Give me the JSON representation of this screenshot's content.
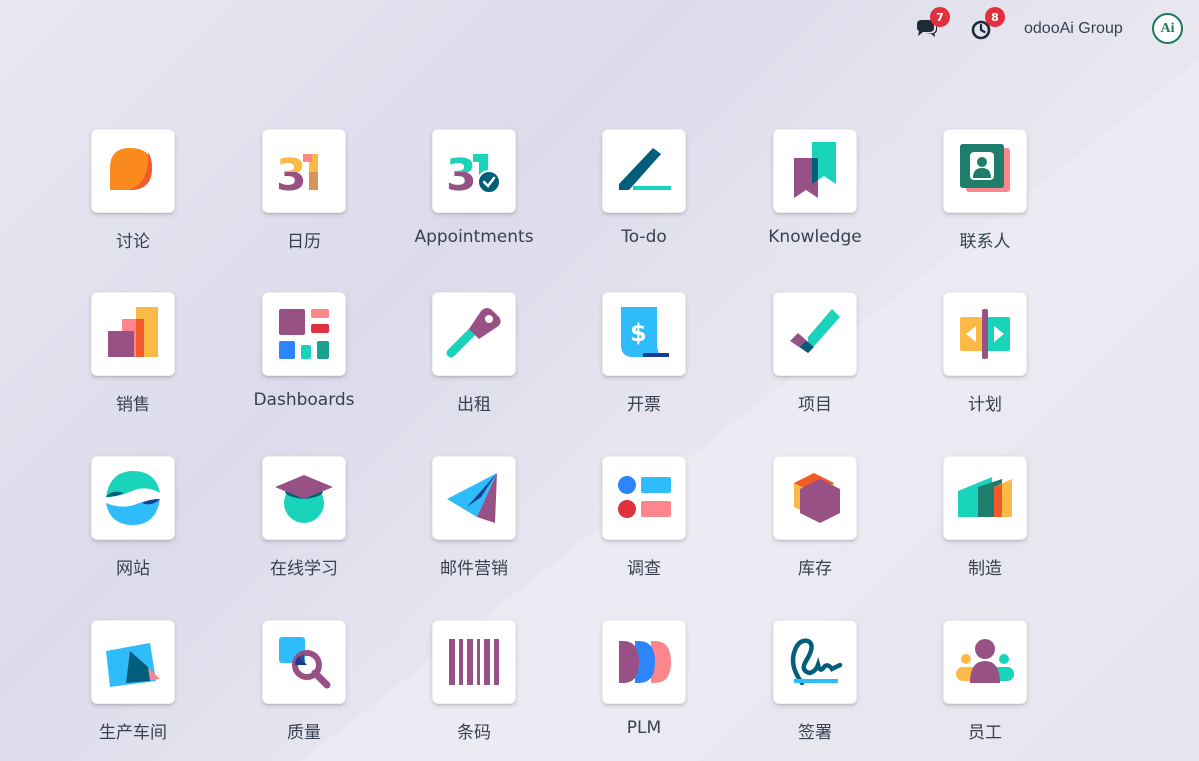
{
  "topbar": {
    "messages_badge": "7",
    "activity_badge": "8",
    "company_name": "odooAi Group",
    "avatar_text": "Ai"
  },
  "apps": [
    {
      "label": "讨论",
      "icon": "discuss-icon"
    },
    {
      "label": "日历",
      "icon": "calendar-icon"
    },
    {
      "label": "Appointments",
      "icon": "appointments-icon"
    },
    {
      "label": "To-do",
      "icon": "todo-icon"
    },
    {
      "label": "Knowledge",
      "icon": "knowledge-icon"
    },
    {
      "label": "联系人",
      "icon": "contacts-icon"
    },
    {
      "label": "销售",
      "icon": "sales-icon"
    },
    {
      "label": "Dashboards",
      "icon": "dashboards-icon"
    },
    {
      "label": "出租",
      "icon": "rental-icon"
    },
    {
      "label": "开票",
      "icon": "invoicing-icon"
    },
    {
      "label": "项目",
      "icon": "project-icon"
    },
    {
      "label": "计划",
      "icon": "planning-icon"
    },
    {
      "label": "网站",
      "icon": "website-icon"
    },
    {
      "label": "在线学习",
      "icon": "elearning-icon"
    },
    {
      "label": "邮件营销",
      "icon": "email-marketing-icon"
    },
    {
      "label": "调查",
      "icon": "surveys-icon"
    },
    {
      "label": "库存",
      "icon": "inventory-icon"
    },
    {
      "label": "制造",
      "icon": "manufacturing-icon"
    },
    {
      "label": "生产车间",
      "icon": "shop-floor-icon"
    },
    {
      "label": "质量",
      "icon": "quality-icon"
    },
    {
      "label": "条码",
      "icon": "barcode-icon"
    },
    {
      "label": "PLM",
      "icon": "plm-icon"
    },
    {
      "label": "签署",
      "icon": "sign-icon"
    },
    {
      "label": "员工",
      "icon": "employees-icon"
    }
  ],
  "colors": {
    "badge": "#e0313d",
    "purple": "#985184",
    "teal": "#1ad3bb",
    "dark_teal": "#005e7a",
    "orange": "#fc868b",
    "yellow": "#fbb945",
    "blue": "#2ebcfa"
  }
}
